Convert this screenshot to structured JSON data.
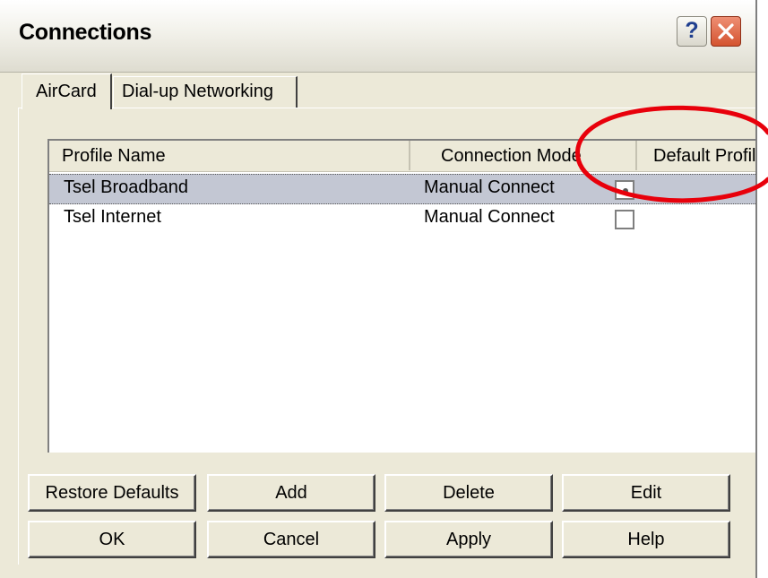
{
  "window": {
    "title": "Connections",
    "help_label": "?"
  },
  "tabs": [
    {
      "label": "AirCard",
      "active": true
    },
    {
      "label": "Dial-up Networking",
      "active": false
    }
  ],
  "profiles": {
    "columns": [
      "Profile Name",
      "Connection Mode",
      "Default Profile"
    ],
    "rows": [
      {
        "name": "Tsel Broadband",
        "mode": "Manual Connect",
        "default": true,
        "selected": true
      },
      {
        "name": "Tsel Internet",
        "mode": "Manual Connect",
        "default": false,
        "selected": false
      }
    ]
  },
  "buttons": {
    "row1": [
      "Restore Defaults",
      "Add",
      "Delete",
      "Edit"
    ],
    "row2": [
      "OK",
      "Cancel",
      "Apply",
      "Help"
    ]
  },
  "colors": {
    "dialog_bg": "#ece9d8",
    "selection": "#c3c7d3",
    "close_button": "#d4532f",
    "annotation": "#e8000b"
  },
  "icons": {
    "help": "help-icon",
    "close": "close-icon",
    "annotation": "highlight-circle"
  }
}
